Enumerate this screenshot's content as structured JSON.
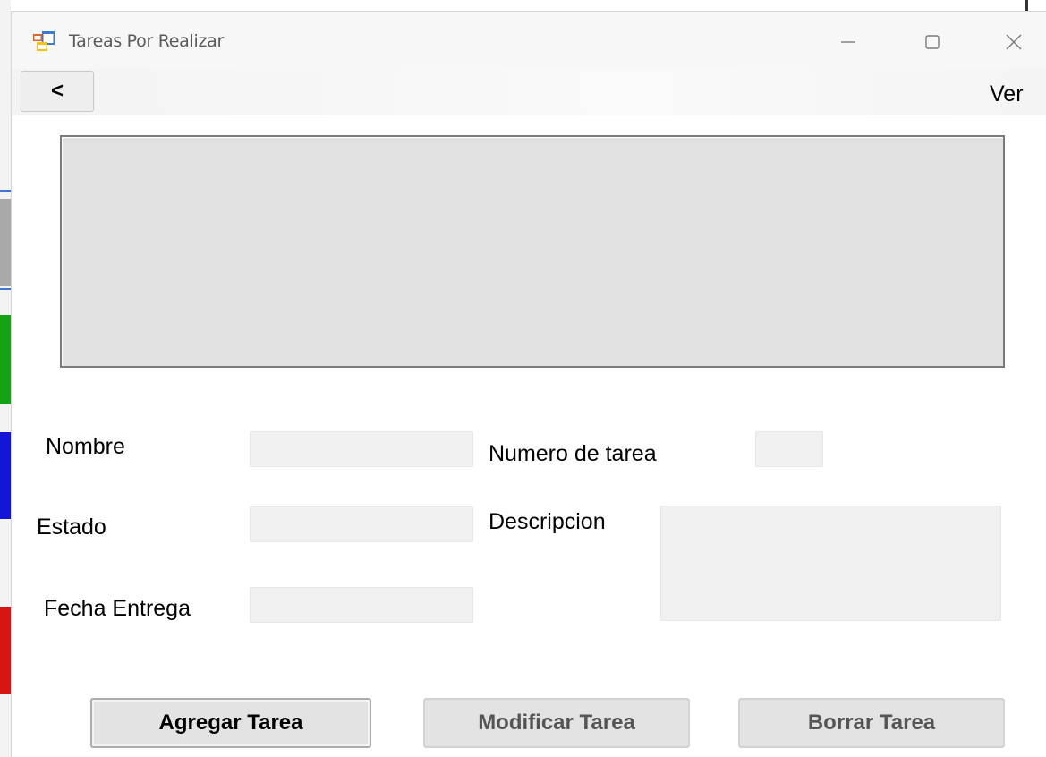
{
  "window": {
    "title": "Tareas Por Realizar"
  },
  "menubar": {
    "back_label": "<",
    "ver_label": "Ver"
  },
  "form": {
    "nombre_label": "Nombre",
    "nombre_value": "",
    "numero_label": "Numero de tarea",
    "numero_value": "",
    "estado_label": "Estado",
    "estado_value": "",
    "descripcion_label": "Descripcion",
    "descripcion_value": "",
    "fecha_label": "Fecha Entrega",
    "fecha_value": ""
  },
  "buttons": {
    "agregar": "Agregar Tarea",
    "modificar": "Modificar Tarea",
    "borrar": "Borrar Tarea"
  },
  "colors": {
    "grid_background": "#e1e1e1",
    "field_background": "#f0f0f0",
    "button_background": "#e3e3e3"
  }
}
